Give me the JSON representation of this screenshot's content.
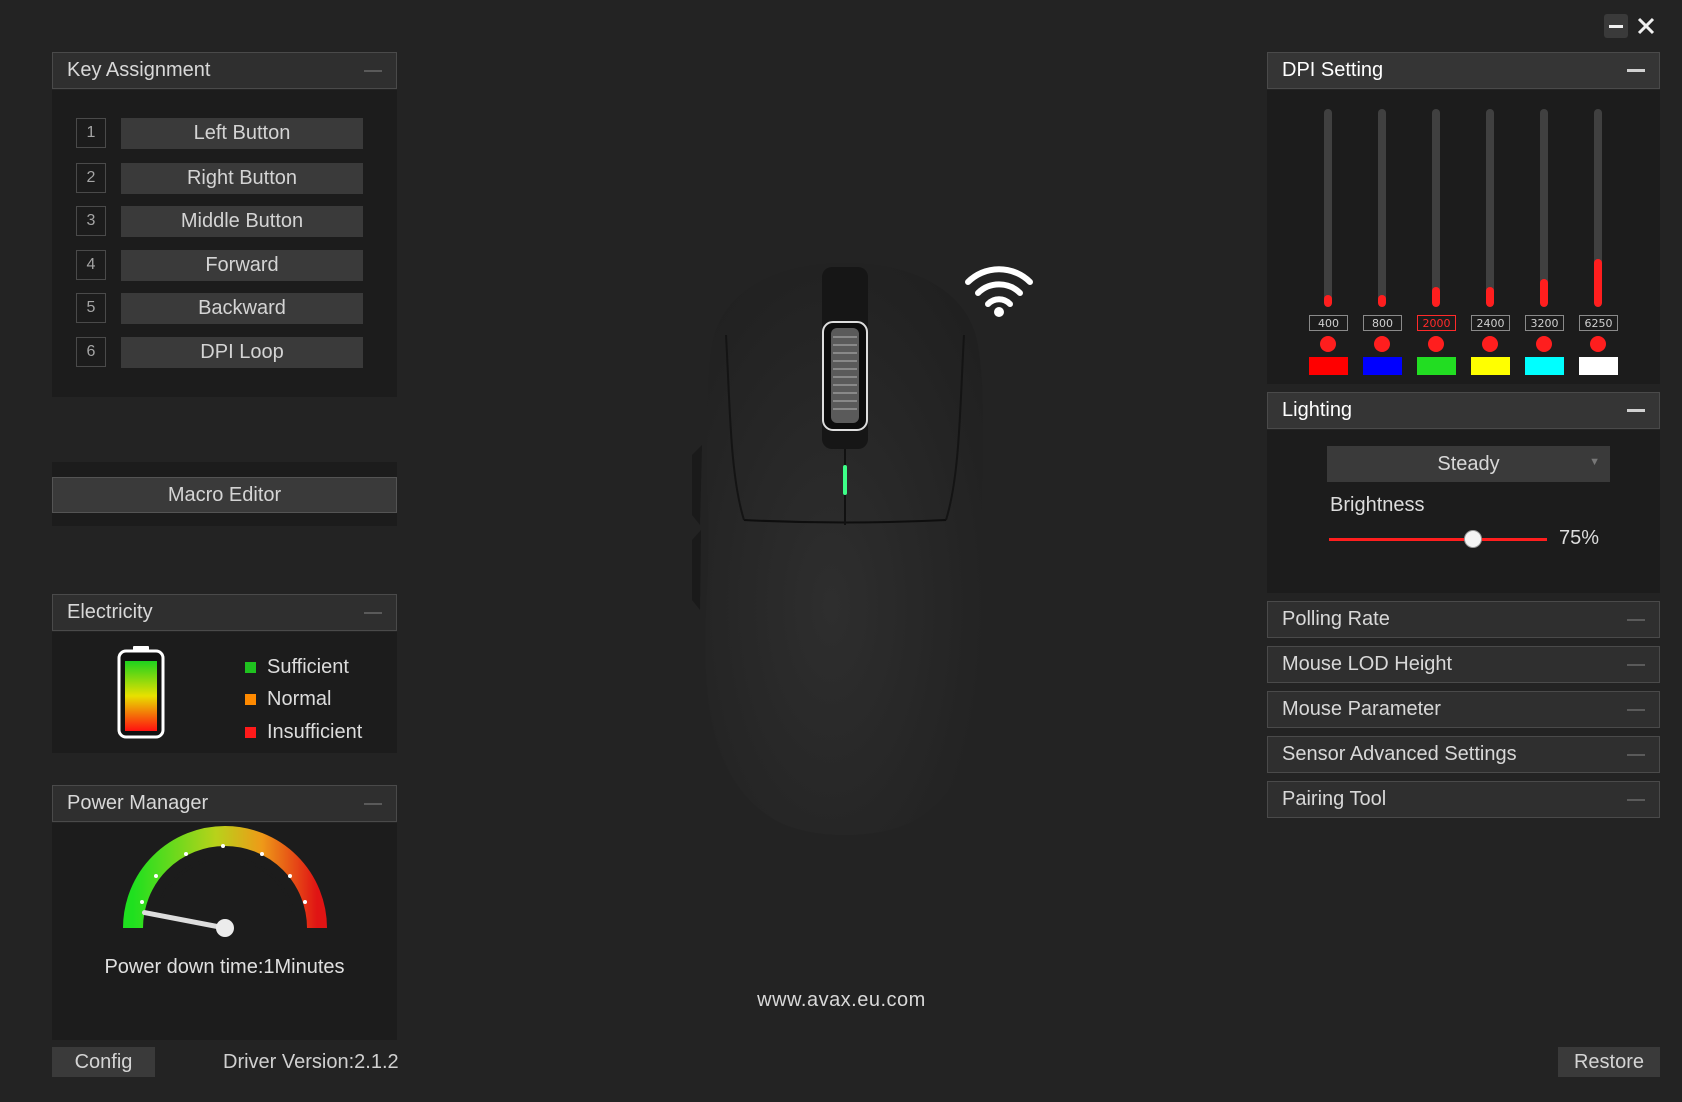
{
  "window": {
    "minimize_icon": "minimize-icon",
    "close_icon": "close-icon"
  },
  "key_assignment": {
    "title": "Key Assignment",
    "keys": [
      {
        "num": "1",
        "label": "Left Button"
      },
      {
        "num": "2",
        "label": "Right Button"
      },
      {
        "num": "3",
        "label": "Middle Button"
      },
      {
        "num": "4",
        "label": "Forward"
      },
      {
        "num": "5",
        "label": "Backward"
      },
      {
        "num": "6",
        "label": "DPI Loop"
      }
    ]
  },
  "macro_editor": {
    "label": "Macro Editor"
  },
  "electricity": {
    "title": "Electricity",
    "legend": [
      {
        "label": "Sufficient",
        "color": "#1fc21f"
      },
      {
        "label": "Normal",
        "color": "#ff8a00"
      },
      {
        "label": "Insufficient",
        "color": "#ff1a1a"
      }
    ]
  },
  "power_manager": {
    "title": "Power Manager",
    "text": "Power down time:1Minutes",
    "gauge_level": 0.06
  },
  "website": "www.avax.eu.com",
  "footer": {
    "config_label": "Config",
    "driver_version": "Driver Version:2.1.2",
    "restore_label": "Restore"
  },
  "dpi_setting": {
    "title": "DPI Setting",
    "stages": [
      {
        "value": "400",
        "level": 0.06,
        "color": "#ff0000",
        "active": false
      },
      {
        "value": "800",
        "level": 0.06,
        "color": "#0000ff",
        "active": false
      },
      {
        "value": "2000",
        "level": 0.1,
        "color": "#22dd22",
        "active": true
      },
      {
        "value": "2400",
        "level": 0.1,
        "color": "#ffff00",
        "active": false
      },
      {
        "value": "3200",
        "level": 0.14,
        "color": "#00ffff",
        "active": false
      },
      {
        "value": "6250",
        "level": 0.24,
        "color": "#ffffff",
        "active": false
      }
    ]
  },
  "lighting": {
    "title": "Lighting",
    "mode": "Steady",
    "brightness_label": "Brightness",
    "brightness_value": "75%",
    "brightness_level": 0.66
  },
  "collapsed_panels": [
    {
      "title": "Polling Rate"
    },
    {
      "title": "Mouse LOD Height"
    },
    {
      "title": "Mouse Parameter"
    },
    {
      "title": "Sensor Advanced Settings"
    },
    {
      "title": "Pairing Tool"
    }
  ],
  "accent_color": "#ff1e1e"
}
